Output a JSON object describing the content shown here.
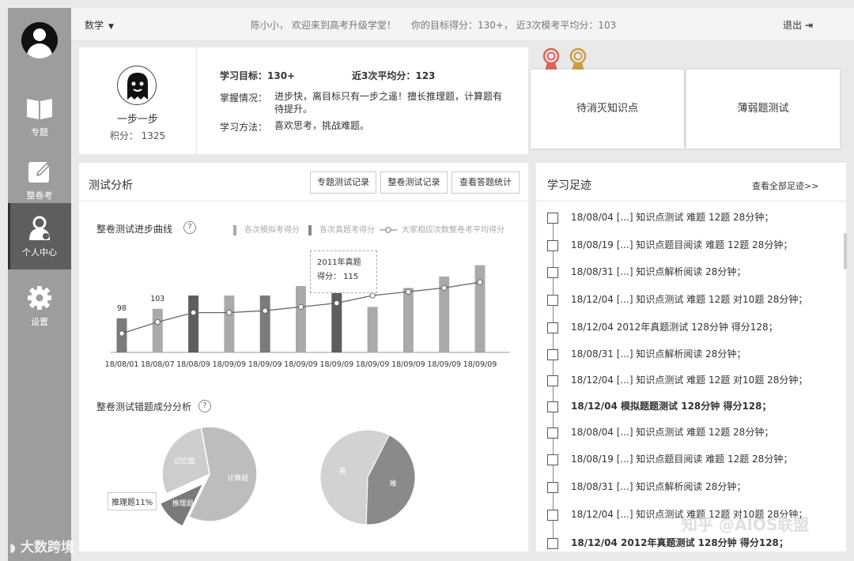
{
  "sidebar": {
    "items": [
      {
        "label": "专题",
        "icon": "book-icon"
      },
      {
        "label": "整卷考",
        "icon": "edit-icon"
      },
      {
        "label": "个人中心",
        "icon": "user-icon"
      },
      {
        "label": "设置",
        "icon": "gear-icon"
      }
    ],
    "active": 2
  },
  "topbar": {
    "subject": "数学",
    "greeting": "陈小小，  欢迎来到高考升级学堂！",
    "target": "你的目标得分：130+，  近3次模考平均分：103",
    "logout": "退出"
  },
  "profile": {
    "name": "一步一步",
    "score": "积分：  1325",
    "goal": "学习目标：130+",
    "avg": "近3次平均分：123",
    "mastery_label": "掌握情况：",
    "mastery_text": "进步快，离目标只有一步之遥！擅长推理题，计算题有待提升。",
    "method_label": "学习方法：",
    "method_text": "喜欢思考，挑战难题。"
  },
  "tiles": [
    "待消灭知识点",
    "薄弱题测试"
  ],
  "analysis": {
    "title": "测试分析",
    "buttons": [
      "专题测试记录",
      "整卷测试记录",
      "查看答题统计"
    ],
    "progress_title": "整卷测试进步曲线",
    "error_title": "整卷测试错题成分分析",
    "legend": [
      "各次模拟考得分",
      "各次真题考得分",
      "大家相应次数整卷考平均得分"
    ],
    "tooltip": {
      "title": "2011年真题",
      "score": "得分：  115"
    },
    "pie_label": "推理题11%"
  },
  "chart_data": [
    {
      "type": "bar",
      "title": "整卷测试进步曲线",
      "categories": [
        "18/08/01",
        "18/08/07",
        "18/08/09",
        "18/09/09",
        "18/09/09",
        "18/09/09",
        "18/09/09",
        "18/09/09",
        "18/09/09",
        "18/09/09",
        "18/09/09"
      ],
      "series": [
        {
          "name": "各次模拟考得分",
          "values": [
            98,
            103,
            110,
            110,
            110,
            115,
            115,
            104,
            114,
            120,
            126
          ],
          "kind": "bar"
        },
        {
          "name": "大家相应次数整卷考平均得分",
          "values": [
            90,
            96,
            101,
            101,
            102,
            104,
            106,
            110,
            112,
            114,
            117
          ],
          "kind": "line"
        }
      ],
      "bar_colors": [
        "#7b7b7b",
        "#aaaaaa",
        "#5e5e5e",
        "#aaaaaa",
        "#7b7b7b",
        "#aaaaaa",
        "#5e5e5e",
        "#aaaaaa",
        "#aaaaaa",
        "#aaaaaa",
        "#aaaaaa"
      ],
      "data_labels": [
        "98",
        "103"
      ],
      "ylim": [
        80,
        130
      ]
    },
    {
      "type": "pie",
      "title": "整卷测试错题成分分析",
      "labels": [
        "计算题",
        "推理题",
        "记忆题"
      ],
      "values": [
        60,
        11,
        29
      ]
    },
    {
      "type": "pie",
      "labels": [
        "难",
        "易"
      ],
      "values": [
        43,
        57
      ]
    }
  ],
  "footprint": {
    "title": "学习足迹",
    "more": "查看全部足迹>>",
    "items": [
      {
        "text": "18/08/04    [...]  知识点测试   难题  12题   28分钟；",
        "bold": false
      },
      {
        "text": "18/08/19    [...]  知识点题目阅读   难题  12题   28分钟；",
        "bold": false
      },
      {
        "text": "18/08/31    [...]  知识点解析阅读   28分钟；",
        "bold": false
      },
      {
        "text": "18/12/04    [...]  知识点测试   难题  12题   对10题  28分钟；",
        "bold": false
      },
      {
        "text": "18/12/04    2012年真题测试   128分钟   得分128；",
        "bold": false
      },
      {
        "text": "18/08/31    [...]  知识点解析阅读   28分钟；",
        "bold": false
      },
      {
        "text": "18/12/04    [...]  知识点测试   难题  12题   对10题  28分钟；",
        "bold": false
      },
      {
        "text": "18/12/04    模拟题题测试   128分钟   得分128；",
        "bold": true
      },
      {
        "text": "18/08/04    [...]  知识点测试   难题  12题   28分钟；",
        "bold": false
      },
      {
        "text": "18/08/19    [...]  知识点题目阅读   难题  12题   28分钟；",
        "bold": false
      },
      {
        "text": "18/08/31    [...]  知识点解析阅读   28分钟；",
        "bold": false
      },
      {
        "text": "18/12/04    [...]  知识点测试   难题  12题   对10题  28分钟；",
        "bold": false
      },
      {
        "text": "18/12/04    2012年真题测试   128分钟   得分128；",
        "bold": true
      }
    ]
  },
  "watermarks": {
    "left": "大数跨境",
    "right": "知乎 @AIOS联盟"
  }
}
